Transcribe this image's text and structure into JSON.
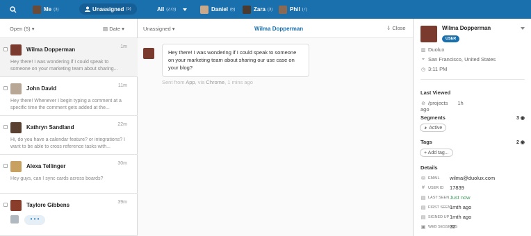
{
  "topbar": {
    "search_icon": "search-icon",
    "me": {
      "label": "Me",
      "count": "(3)"
    },
    "unassigned": {
      "label": "Unassigned",
      "count": "(5)"
    },
    "all": {
      "label": "All",
      "count": "(273)"
    },
    "daniel": {
      "label": "Daniel",
      "count": "(6)"
    },
    "zara": {
      "label": "Zara",
      "count": "(3)"
    },
    "phil": {
      "label": "Phil",
      "count": "(7)"
    }
  },
  "list": {
    "filter": "Open (5)",
    "sort": "Date",
    "conversations": [
      {
        "name": "Wilma Dopperman",
        "time": "1m",
        "preview": "Hey there! I was wondering if I could speak to someone on your marketing team about sharing..."
      },
      {
        "name": "John David",
        "time": "11m",
        "preview": "Hey there! Whenever I begin typing a comment at a specific time the comment gets added at the..."
      },
      {
        "name": "Kathryn Sandland",
        "time": "22m",
        "preview": "Hi, do you have a calendar feature? or integrations? I want to be able to cross reference tasks with..."
      },
      {
        "name": "Alexa Tellinger",
        "time": "30m",
        "preview": "Hey guys, can I sync cards across boards?"
      },
      {
        "name": "Taylore Gibbens",
        "time": "39m",
        "preview": "• • •"
      }
    ]
  },
  "conversation": {
    "assignee": "Unassigned",
    "title": "Wilma Dopperman",
    "close_label": "Close",
    "message": "Hey there! I was wondering if I could speak to someone on your marketing team about sharing our use case on your blog?",
    "meta_prefix": "Sent from",
    "meta_app": "App",
    "meta_via": ", via",
    "meta_browser": "Chrome",
    "meta_time": ", 1 mins ago"
  },
  "profile": {
    "name": "Wilma Dopperman",
    "badge": "USER",
    "company": "Duolux",
    "location": "San Francisco, United States",
    "local_time": "3:11 PM",
    "last_viewed_title": "Last Viewed",
    "last_viewed_path": "/projects",
    "last_viewed_ago": "1h",
    "last_viewed_ago2": "ago",
    "segments_title": "Segments",
    "segments_count": "3",
    "segment_active": "Active",
    "tags_title": "Tags",
    "tags_count": "2",
    "add_tag": "+ Add tag...",
    "details_title": "Details",
    "details": [
      {
        "label": "EMAIL",
        "value": "wilma@duolux.com"
      },
      {
        "label": "USER ID",
        "value": "17839"
      },
      {
        "label": "LAST SEEN",
        "value": "Just now"
      },
      {
        "label": "FIRST SEEN",
        "value": "1mth ago"
      },
      {
        "label": "SIGNED UP",
        "value": "1mth ago"
      },
      {
        "label": "WEB SESSIONS",
        "value": "32"
      }
    ]
  },
  "colors": {
    "brand": "#1a6fad",
    "green": "#3b9a5b"
  }
}
